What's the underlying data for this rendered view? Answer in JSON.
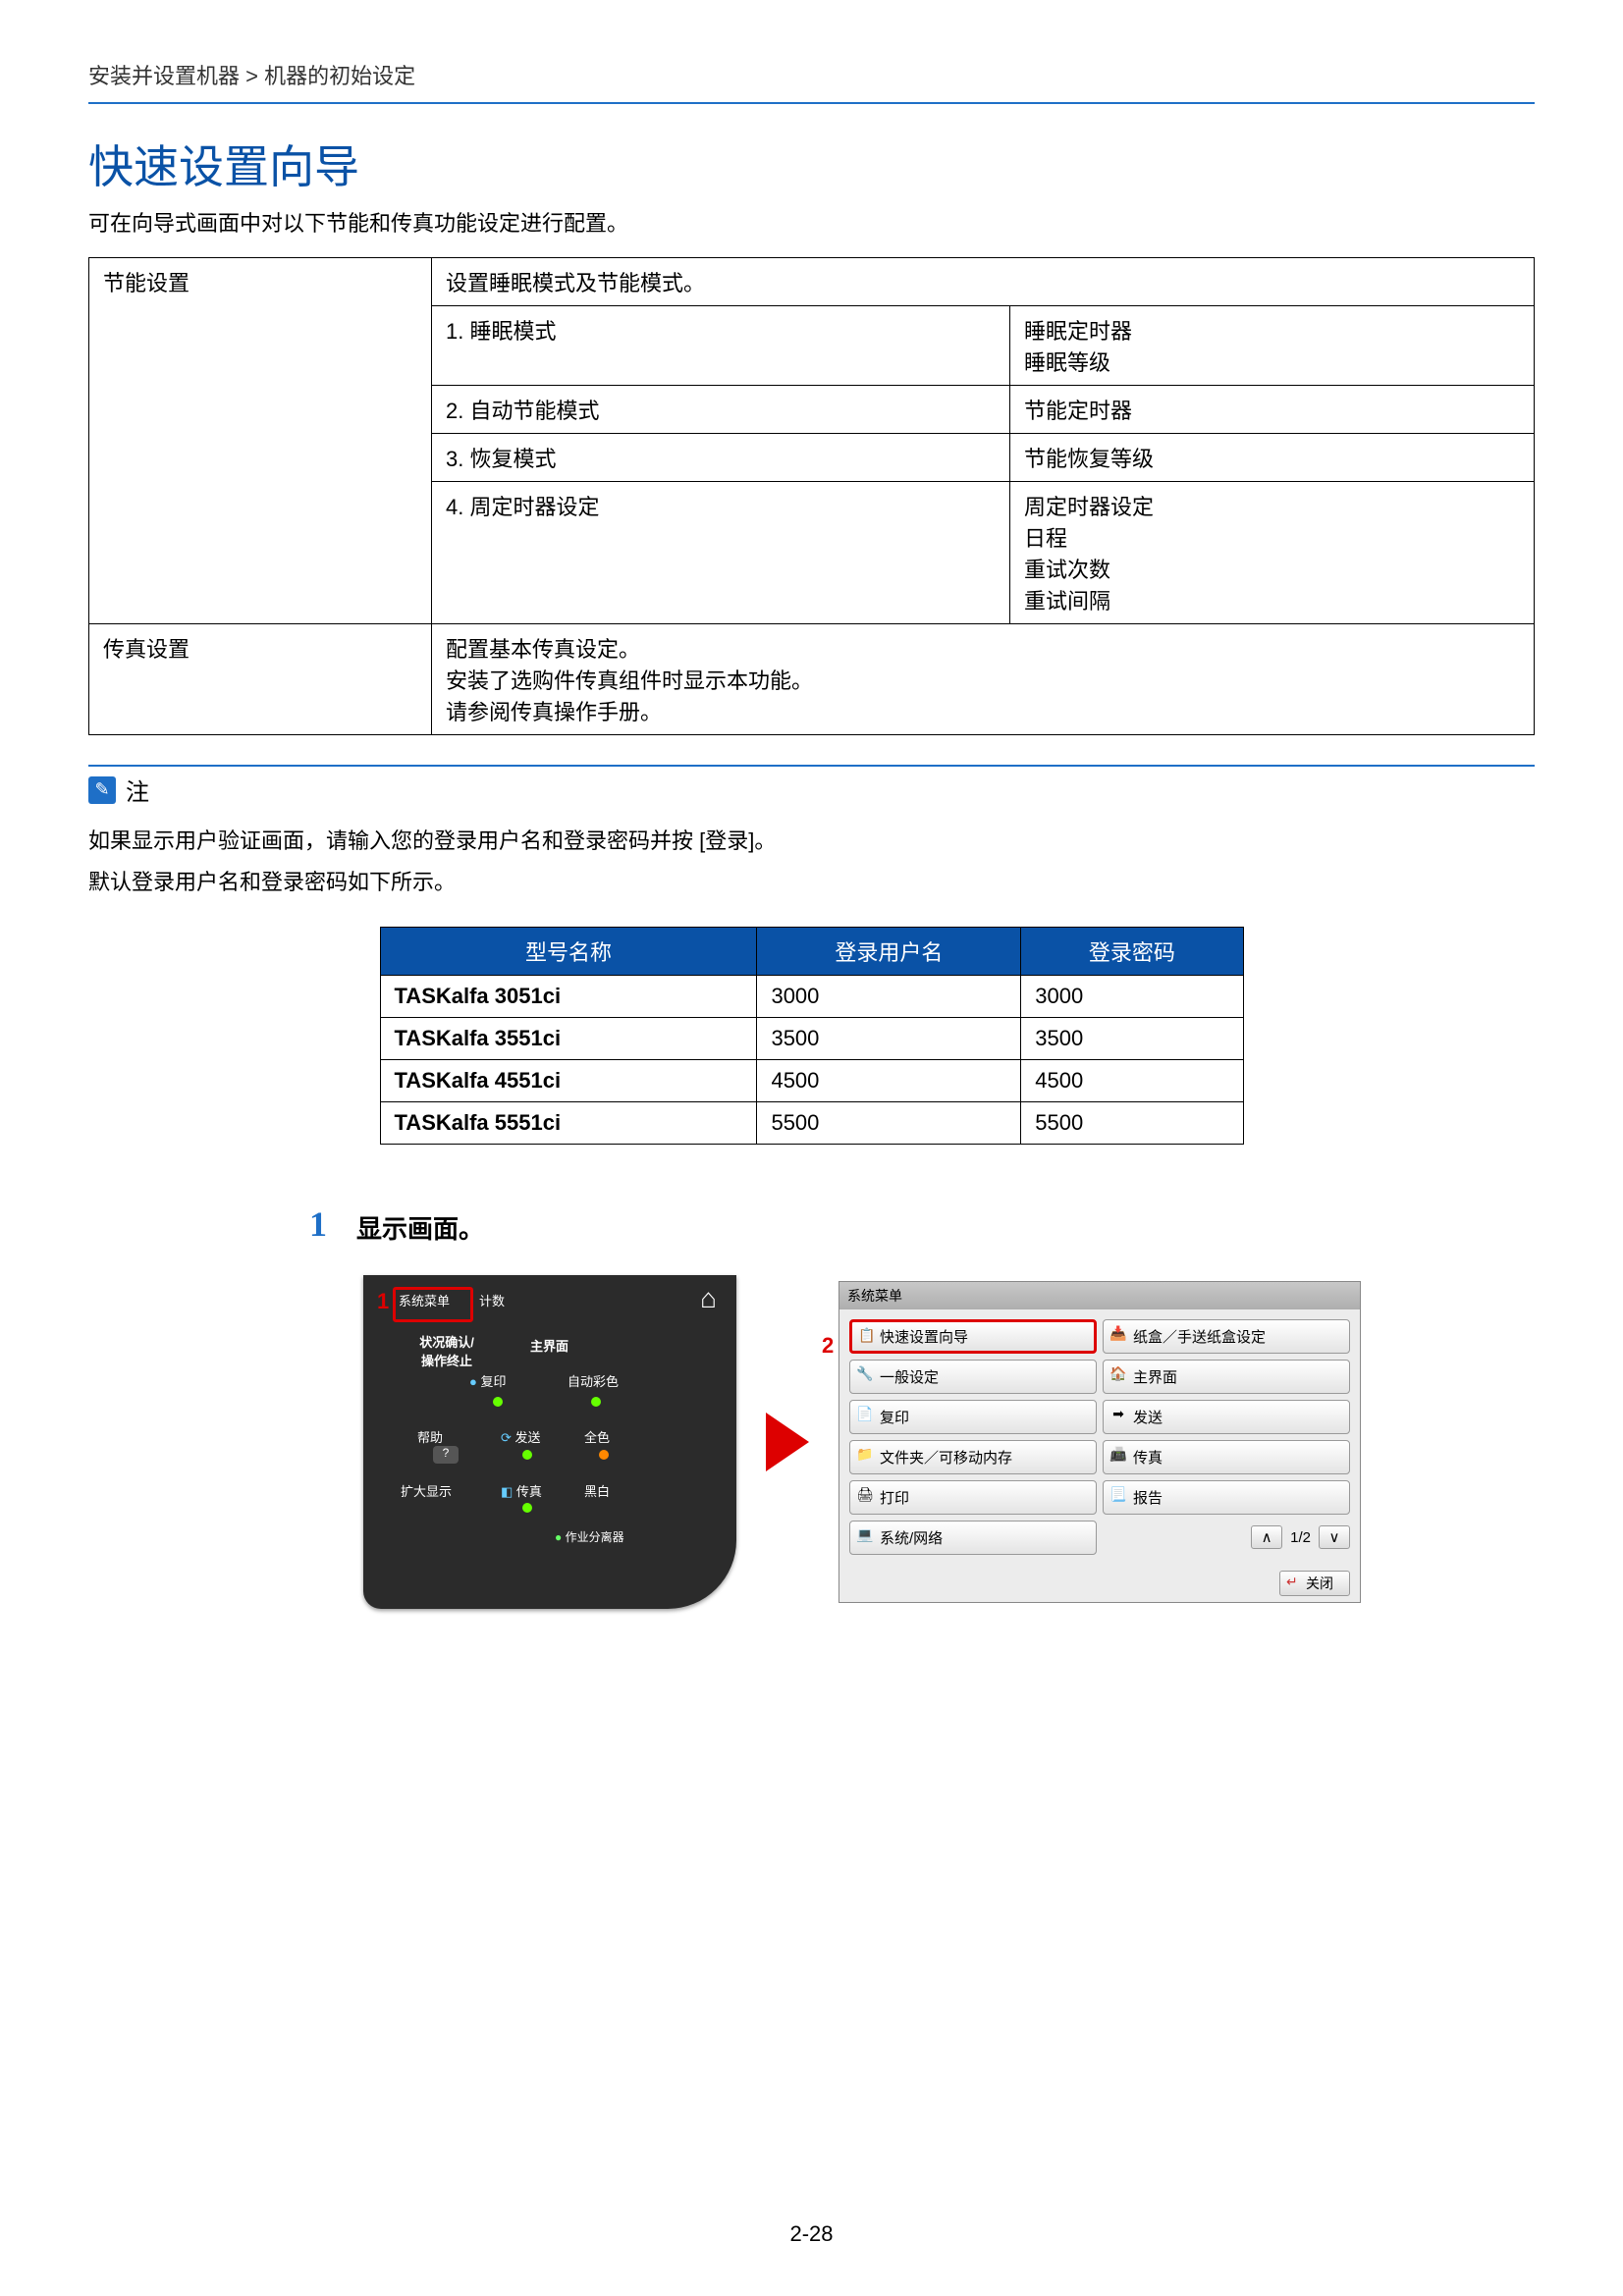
{
  "breadcrumb": "安装并设置机器 > 机器的初始设定",
  "title": "快速设置向导",
  "intro": "可在向导式画面中对以下节能和传真功能设定进行配置。",
  "settings_table": {
    "r1c1": "节能设置",
    "r1c2": "设置睡眠模式及节能模式。",
    "r2c2": "1. 睡眠模式",
    "r2c3": "睡眠定时器\n睡眠等级",
    "r3c2": "2. 自动节能模式",
    "r3c3": "节能定时器",
    "r4c2": "3. 恢复模式",
    "r4c3": "节能恢复等级",
    "r5c2": "4. 周定时器设定",
    "r5c3": "周定时器设定\n日程\n重试次数\n重试间隔",
    "r6c1": "传真设置",
    "r6c2": "配置基本传真设定。\n安装了选购件传真组件时显示本功能。\n请参阅传真操作手册。"
  },
  "note": {
    "label": "注",
    "line1": "如果显示用户验证画面，请输入您的登录用户名和登录密码并按 [登录]。",
    "line2": "默认登录用户名和登录密码如下所示。"
  },
  "login_table": {
    "headers": [
      "型号名称",
      "登录用户名",
      "登录密码"
    ],
    "rows": [
      [
        "TASKalfa 3051ci",
        "3000",
        "3000"
      ],
      [
        "TASKalfa 3551ci",
        "3500",
        "3500"
      ],
      [
        "TASKalfa 4551ci",
        "4500",
        "4500"
      ],
      [
        "TASKalfa 5551ci",
        "5500",
        "5500"
      ]
    ]
  },
  "step": {
    "num": "1",
    "title": "显示画面。"
  },
  "panel": {
    "sysmenu": "系统菜单",
    "count": "计数",
    "status_stop": "状况确认/\n操作终止",
    "mainscreen": "主界面",
    "copy": "复印",
    "autocolor": "自动彩色",
    "help": "帮助",
    "send": "发送",
    "fullcolor": "全色",
    "zoom": "扩大显示",
    "fax": "传真",
    "bw": "黑白",
    "separator_led": "作业分离器",
    "callout1": "1"
  },
  "menuwin": {
    "titlebar": "系统菜单",
    "callout2": "2",
    "items_left": [
      {
        "label": "快速设置向导",
        "selected": true,
        "icon": "📋"
      },
      {
        "label": "一般设定",
        "icon": "🔧"
      },
      {
        "label": "复印",
        "icon": "📄"
      },
      {
        "label": "文件夹／可移动内存",
        "icon": "📁"
      },
      {
        "label": "打印",
        "icon": "🖨"
      },
      {
        "label": "系统/网络",
        "icon": "💻"
      }
    ],
    "items_right": [
      {
        "label": "纸盒／手送纸盒设定",
        "icon": "📥"
      },
      {
        "label": "主界面",
        "icon": "🏠"
      },
      {
        "label": "发送",
        "icon": "➡"
      },
      {
        "label": "传真",
        "icon": "📠"
      },
      {
        "label": "报告",
        "icon": "📃"
      }
    ],
    "page_indicator": "1/2",
    "close": "关闭"
  },
  "pagenum": "2-28"
}
